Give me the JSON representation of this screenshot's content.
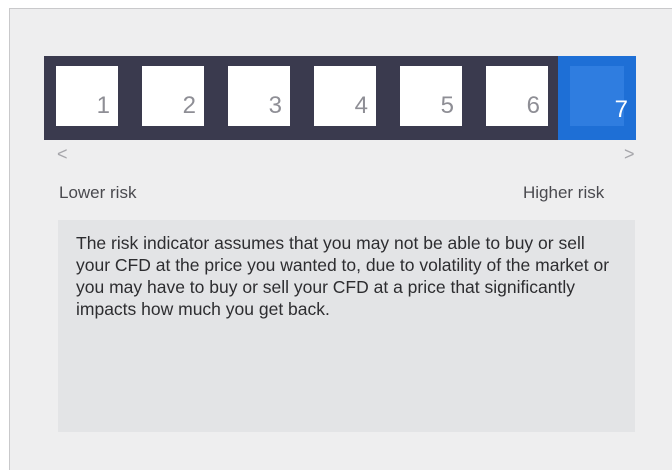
{
  "risk_indicator": {
    "levels": [
      "1",
      "2",
      "3",
      "4",
      "5",
      "6",
      "7"
    ],
    "selected_level": "7",
    "colors": {
      "bar_background": "#3a3a4e",
      "selected": "#1e6fd6",
      "box": "#ffffff",
      "number_text": "#8e8e95"
    },
    "prev_arrow": "<",
    "next_arrow": ">",
    "lower_label": "Lower risk",
    "higher_label": "Higher risk"
  },
  "description": {
    "text": "The risk indicator assumes that you may not be able to buy or sell your CFD at the price you wanted to, due to volatility of the market or you may have to buy or sell your CFD at a price that significantly impacts how much you get back."
  }
}
